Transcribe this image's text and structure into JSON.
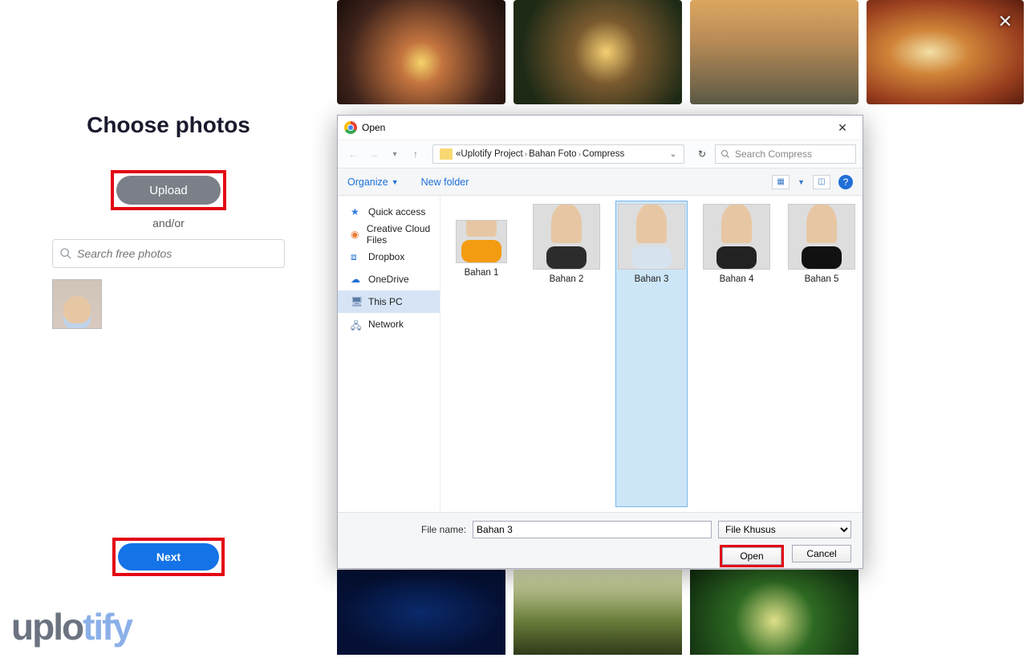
{
  "leftPanel": {
    "title": "Choose photos",
    "uploadLabel": "Upload",
    "andOr": "and/or",
    "searchPlaceholder": "Search free photos",
    "nextLabel": "Next"
  },
  "brand": {
    "part1": "uplo",
    "part2": "tify"
  },
  "dialog": {
    "title": "Open",
    "breadcrumb": {
      "prefix": "«",
      "items": [
        "Uplotify Project",
        "Bahan Foto",
        "Compress"
      ]
    },
    "searchPlaceholder": "Search Compress",
    "toolbar": {
      "organize": "Organize",
      "newFolder": "New folder"
    },
    "sidebar": [
      {
        "label": "Quick access",
        "icon": "star"
      },
      {
        "label": "Creative Cloud Files",
        "icon": "cloud-cc"
      },
      {
        "label": "Dropbox",
        "icon": "dropbox"
      },
      {
        "label": "OneDrive",
        "icon": "onedrive"
      },
      {
        "label": "This PC",
        "icon": "pc",
        "selected": true
      },
      {
        "label": "Network",
        "icon": "network"
      }
    ],
    "files": [
      {
        "name": "Bahan 1"
      },
      {
        "name": "Bahan 2"
      },
      {
        "name": "Bahan 3",
        "selected": true
      },
      {
        "name": "Bahan 4"
      },
      {
        "name": "Bahan 5"
      }
    ],
    "footer": {
      "fileNameLabel": "File name:",
      "fileNameValue": "Bahan 3",
      "fileTypeValue": "File Khusus",
      "openLabel": "Open",
      "cancelLabel": "Cancel"
    },
    "helpChar": "?"
  }
}
